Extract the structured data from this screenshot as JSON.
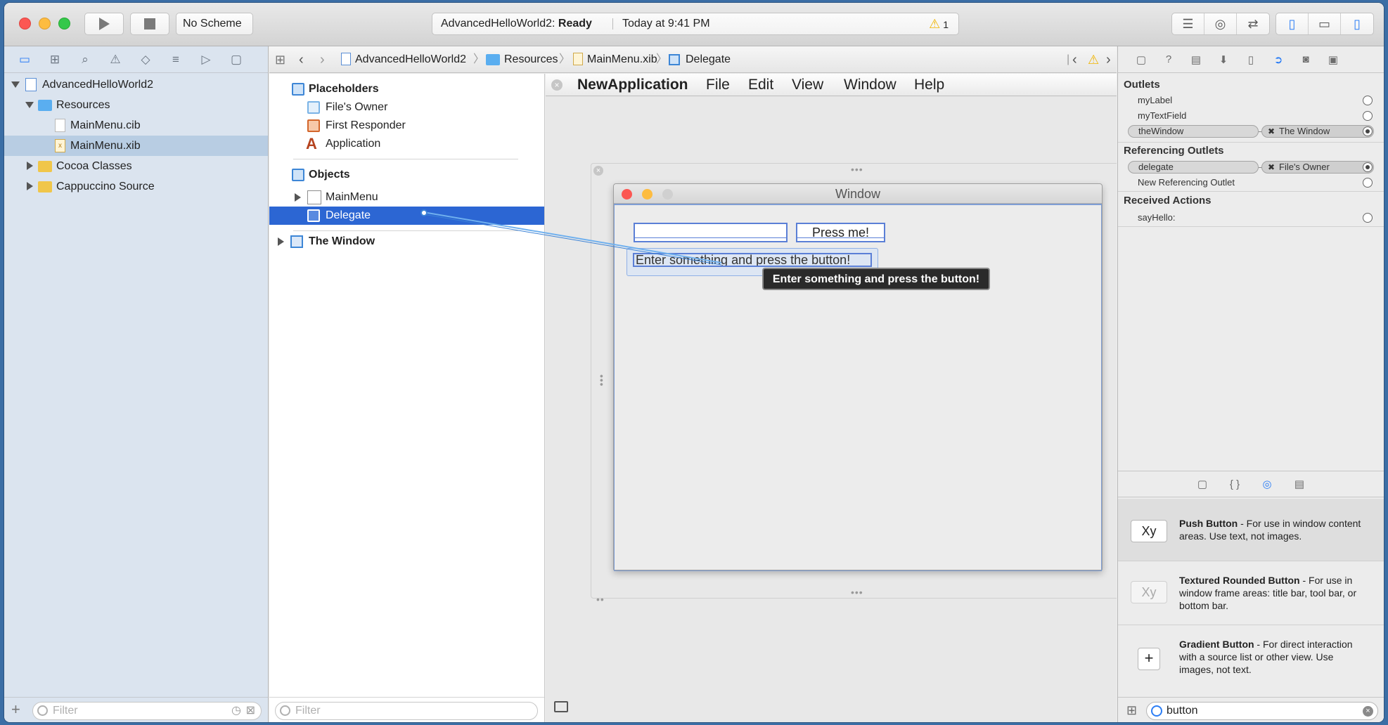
{
  "toolbar": {
    "scheme_label": "No Scheme",
    "project_status": "AdvancedHelloWorld2: Ready",
    "project_name": "AdvancedHelloWorld2:",
    "status_word": "Ready",
    "timestamp": "Today at 9:41 PM",
    "warning_count": "1"
  },
  "navigator": {
    "items": [
      {
        "label": "AdvancedHelloWorld2"
      },
      {
        "label": "Resources"
      },
      {
        "label": "MainMenu.cib"
      },
      {
        "label": "MainMenu.xib"
      },
      {
        "label": "Cocoa Classes"
      },
      {
        "label": "Cappuccino Source"
      }
    ],
    "filter_placeholder": "Filter"
  },
  "jumpbar": {
    "crumbs": [
      "AdvancedHelloWorld2",
      "Resources",
      "MainMenu.xib",
      "Delegate"
    ]
  },
  "outline": {
    "placeholders_title": "Placeholders",
    "placeholders": [
      "File's Owner",
      "First Responder",
      "Application"
    ],
    "objects_title": "Objects",
    "objects": [
      "MainMenu",
      "Delegate"
    ],
    "window_title": "The Window",
    "filter_placeholder": "Filter"
  },
  "canvas": {
    "menus": [
      "NewApplication",
      "File",
      "Edit",
      "View",
      "Window",
      "Help"
    ],
    "window_title": "Window",
    "button_label": "Press me!",
    "label_text": "Enter something and press the button!",
    "tooltip": "Enter something and press the button!"
  },
  "inspector": {
    "outlets_title": "Outlets",
    "outlets": [
      "myLabel",
      "myTextField",
      "theWindow"
    ],
    "thewindow_target": "The Window",
    "ref_title": "Referencing Outlets",
    "ref_outlets": [
      "delegate",
      "New Referencing Outlet"
    ],
    "delegate_target": "File's Owner",
    "actions_title": "Received Actions",
    "actions": [
      "sayHello:"
    ]
  },
  "library": {
    "items": [
      {
        "thumb": "Xy",
        "name": "Push Button",
        "desc": " - For use in window content areas. Use text, not images."
      },
      {
        "thumb": "Xy",
        "name": "Textured Rounded Button",
        "desc": " - For use in window frame areas: title bar, tool bar, or bottom bar."
      },
      {
        "thumb": "+",
        "name": "Gradient Button",
        "desc": " - For direct interaction with a source list or other view. Use images, not text."
      }
    ],
    "search_value": "button"
  },
  "colors": {
    "selection": "#2c66d3",
    "accent": "#2c7ef5",
    "close": "#fc5753",
    "minimize": "#fdbc40",
    "zoom": "#34c84a"
  }
}
